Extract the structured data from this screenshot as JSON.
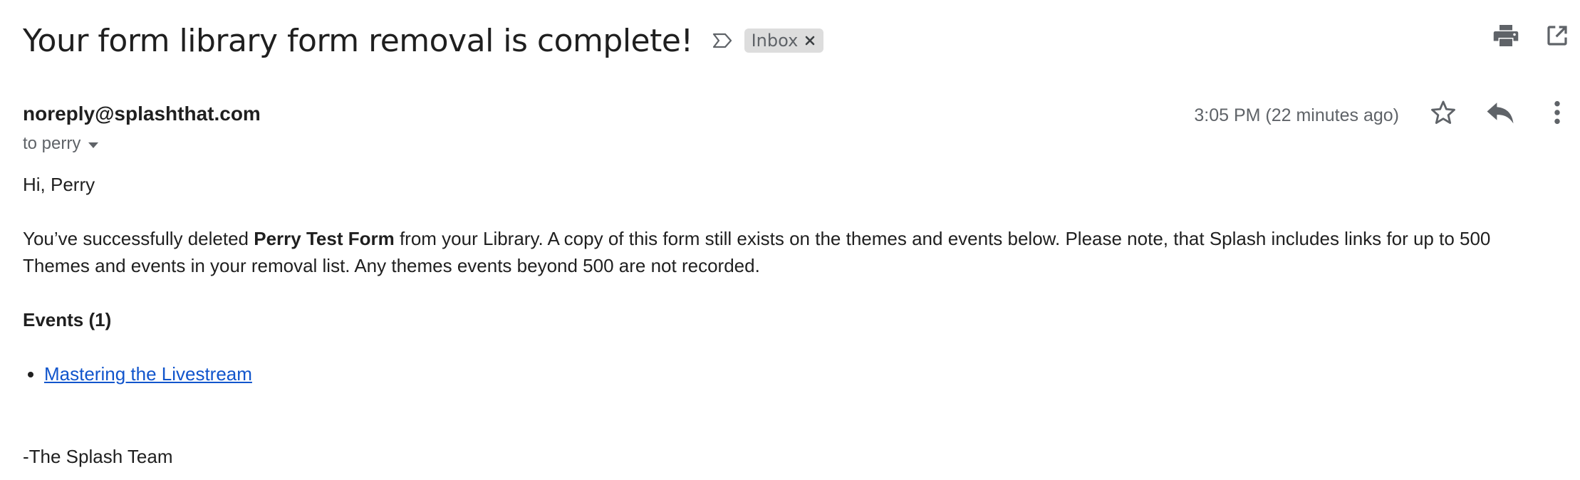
{
  "email": {
    "subject": "Your form library form removal is complete!",
    "label": "Inbox",
    "sender": "noreply@splashthat.com",
    "recipient_line": "to perry",
    "timestamp": "3:05 PM (22 minutes ago)"
  },
  "body": {
    "greeting": "Hi, Perry",
    "para_prefix": "You’ve successfully deleted ",
    "para_bold": "Perry Test Form",
    "para_suffix": " from your Library. A copy of this form still exists on the themes and events below. Please note, that Splash includes links for up to 500 Themes and events in your removal list. Any themes events beyond 500 are not recorded.",
    "events_heading": "Events (1)",
    "events": [
      {
        "label": "Mastering the Livestream"
      }
    ],
    "signoff": "-The Splash Team"
  },
  "colors": {
    "link": "#1155cc",
    "chip_bg": "#dddddd",
    "muted_text": "#5f6368"
  },
  "icons": [
    "importance-marker-icon",
    "close-icon",
    "print-icon",
    "open-in-new-window-icon",
    "caret-down-icon",
    "star-icon",
    "reply-icon",
    "more-vert-icon"
  ]
}
